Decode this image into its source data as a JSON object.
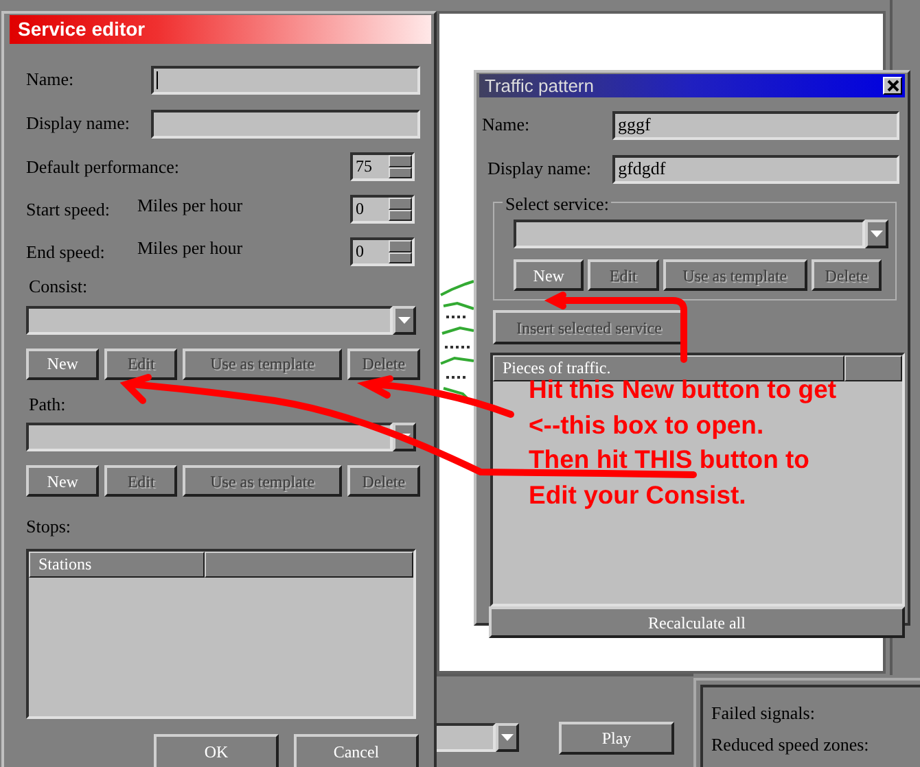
{
  "service_editor": {
    "title": "Service editor",
    "fields": [
      {
        "kind": "text",
        "label": "Name:",
        "focused": true
      },
      {
        "kind": "text",
        "label": "Display name:",
        "focused": false
      },
      {
        "kind": "spin",
        "label": "Default performance:",
        "value": "75"
      },
      {
        "kind": "spin",
        "label": "Start speed:",
        "unit": "Miles per hour",
        "value": "0"
      },
      {
        "kind": "spin",
        "label": "End speed:",
        "unit": "Miles per hour",
        "value": "0"
      }
    ],
    "consist": {
      "label": "Consist:",
      "buttons": [
        {
          "label": "New",
          "disabled": false
        },
        {
          "label": "Edit",
          "disabled": true
        },
        {
          "label": "Use as template",
          "disabled": true
        },
        {
          "label": "Delete",
          "disabled": true
        }
      ]
    },
    "path": {
      "label": "Path:",
      "buttons": [
        {
          "label": "New",
          "disabled": false
        },
        {
          "label": "Edit",
          "disabled": true
        },
        {
          "label": "Use as template",
          "disabled": true
        },
        {
          "label": "Delete",
          "disabled": true
        }
      ]
    },
    "stops": {
      "label": "Stops:",
      "columns": [
        "Stations"
      ]
    },
    "buttons": [
      "OK",
      "Cancel"
    ]
  },
  "traffic_pattern": {
    "title": "Traffic pattern",
    "fields": [
      {
        "label": "Name:",
        "value": "gggf"
      },
      {
        "label": "Display name:",
        "value": "gfdgdf"
      }
    ],
    "select_service": {
      "label": "Select service:",
      "buttons": [
        {
          "label": "New",
          "disabled": false
        },
        {
          "label": "Edit",
          "disabled": true
        },
        {
          "label": "Use as template",
          "disabled": true
        },
        {
          "label": "Delete",
          "disabled": true
        }
      ]
    },
    "insert_button": {
      "label": "Insert selected service",
      "disabled": true
    },
    "pieces": {
      "columns": [
        "Pieces of traffic."
      ]
    },
    "recalculate_button": "Recalculate all"
  },
  "bottom": {
    "play_button": "Play",
    "stats": [
      "Failed signals:",
      "Reduced speed zones:"
    ]
  },
  "annotation": {
    "lines": [
      "Hit this New button to get",
      "<--this box to open.",
      "Then hit THIS button to",
      "Edit your Consist."
    ]
  }
}
